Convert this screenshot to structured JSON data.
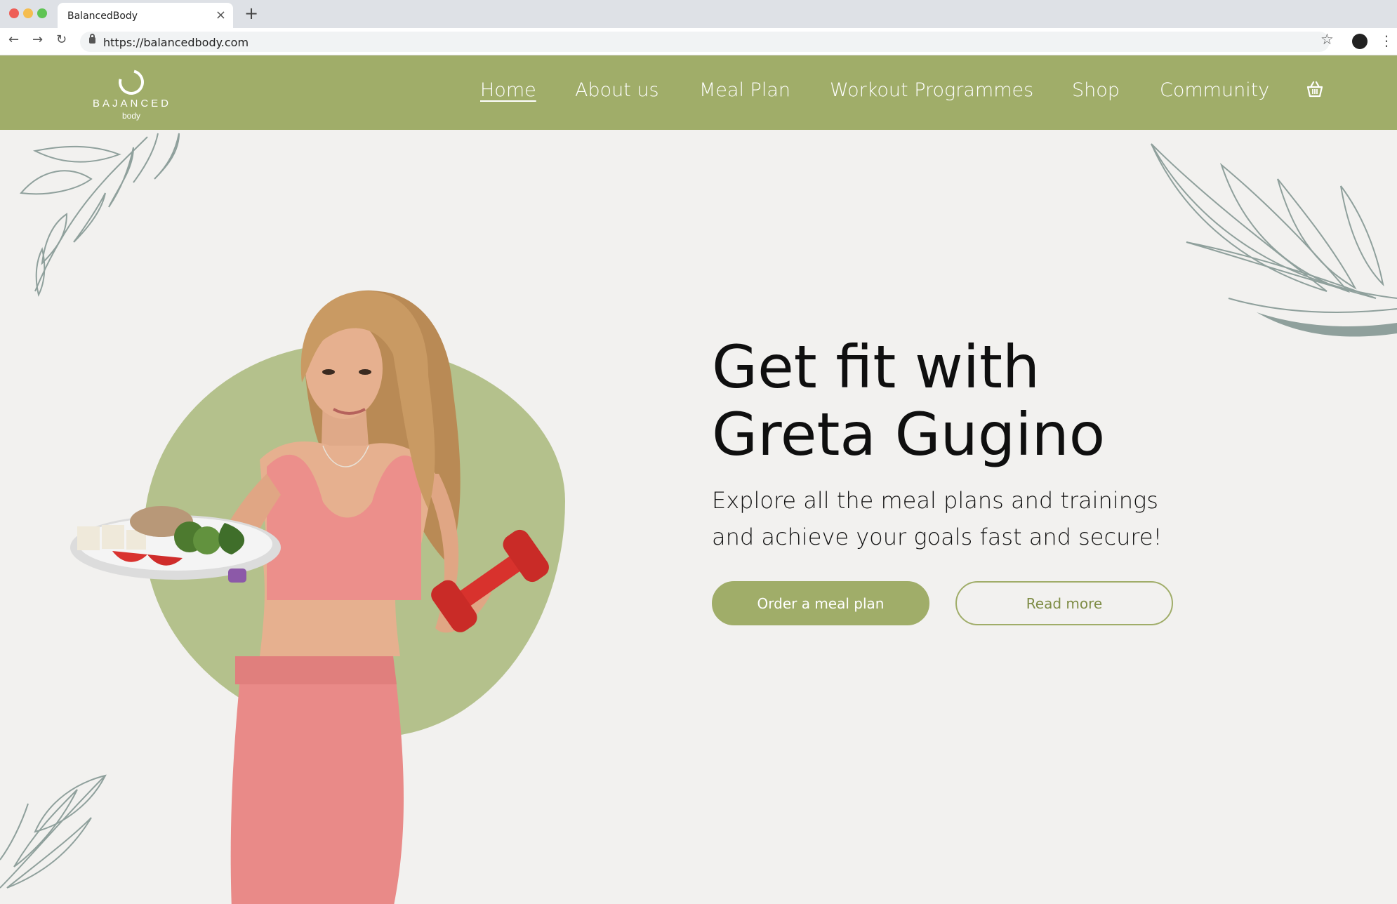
{
  "browser": {
    "tab_title": "BalancedBody",
    "tab_close": "×",
    "new_tab": "+",
    "url": "https://balancedbody.com",
    "back": "←",
    "forward": "→",
    "reload": "↻",
    "bookmark": "☆",
    "menu": "⋮"
  },
  "header": {
    "logo_word": "BAJANCED",
    "logo_sub": "body",
    "nav": [
      {
        "label": "Home",
        "active": true
      },
      {
        "label": "About us"
      },
      {
        "label": "Meal Plan"
      },
      {
        "label": "Workout Programmes"
      },
      {
        "label": "Shop"
      },
      {
        "label": "Community"
      }
    ],
    "cart_icon": "basket-icon"
  },
  "hero": {
    "title_line1": "Get fit with",
    "title_line2": "Greta Gugino",
    "subtitle_line1": "Explore all the meal plans and trainings",
    "subtitle_line2": "and achieve your goals fast and secure!",
    "primary_button": "Order a meal plan",
    "secondary_button": "Read more"
  },
  "colors": {
    "brand_green": "#a0ad69",
    "background": "#f2f1ef",
    "leaf_stroke": "#8fa09c",
    "outfit_pink": "#e98a88",
    "dumbbell_red": "#d8322d"
  }
}
